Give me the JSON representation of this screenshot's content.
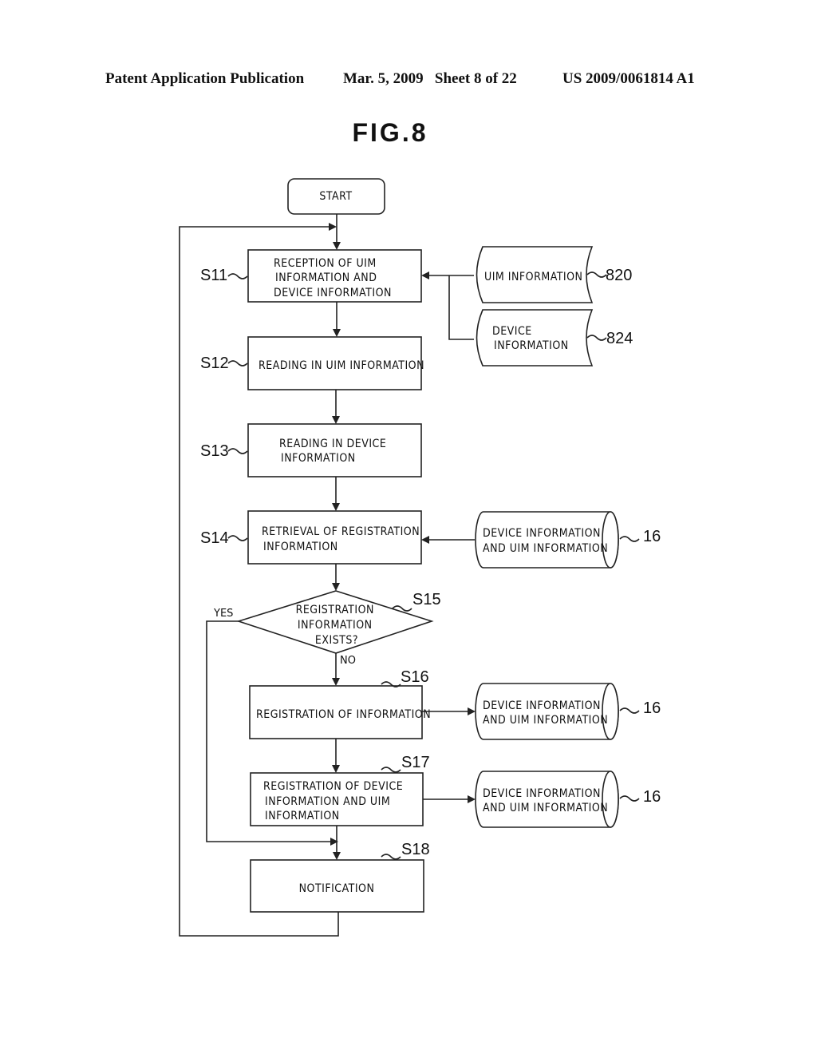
{
  "header": {
    "left": "Patent Application Publication",
    "middle": "Mar. 5, 2009   Sheet 8 of 22",
    "right": "US 2009/0061814 A1"
  },
  "figure": {
    "title": "FIG.8",
    "start": "START",
    "steps": {
      "s11": {
        "label": "S11",
        "lines": [
          "RECEPTION OF UIM",
          "INFORMATION AND",
          "DEVICE INFORMATION"
        ]
      },
      "s12": {
        "label": "S12",
        "lines": [
          "READING IN UIM INFORMATION"
        ]
      },
      "s13": {
        "label": "S13",
        "lines": [
          "READING IN DEVICE",
          "INFORMATION"
        ]
      },
      "s14": {
        "label": "S14",
        "lines": [
          "RETRIEVAL OF REGISTRATION",
          "INFORMATION"
        ]
      },
      "s15": {
        "label": "S15",
        "lines": [
          "REGISTRATION",
          "INFORMATION",
          "EXISTS?"
        ],
        "yes": "YES",
        "no": "NO"
      },
      "s16": {
        "label": "S16",
        "lines": [
          "REGISTRATION OF INFORMATION"
        ]
      },
      "s17": {
        "label": "S17",
        "lines": [
          "REGISTRATION OF DEVICE",
          "INFORMATION AND UIM",
          "INFORMATION"
        ]
      },
      "s18": {
        "label": "S18",
        "lines": [
          "NOTIFICATION"
        ]
      }
    },
    "data_sources": {
      "uim": {
        "ref": "820",
        "lines": [
          "UIM INFORMATION"
        ]
      },
      "device": {
        "ref": "824",
        "lines": [
          "DEVICE",
          "INFORMATION"
        ]
      },
      "db_s14": {
        "ref": "16",
        "lines": [
          "DEVICE INFORMATION",
          "AND UIM INFORMATION"
        ]
      },
      "db_s16": {
        "ref": "16",
        "lines": [
          "DEVICE INFORMATION",
          "AND UIM INFORMATION"
        ]
      },
      "db_s17": {
        "ref": "16",
        "lines": [
          "DEVICE INFORMATION",
          "AND UIM INFORMATION"
        ]
      }
    }
  }
}
